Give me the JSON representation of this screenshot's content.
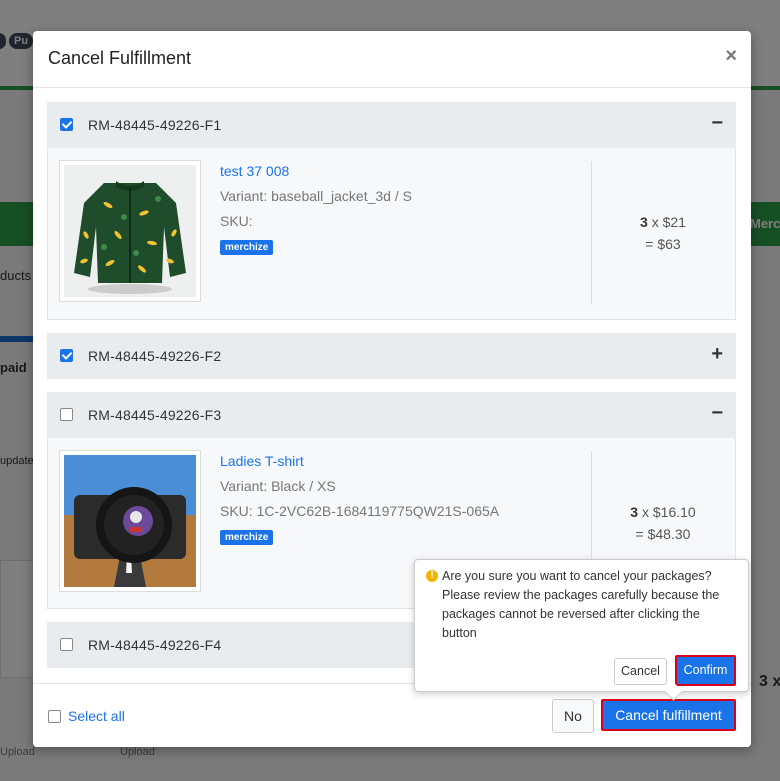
{
  "background": {
    "pill_label": "Pu",
    "text_fragments": [
      "ducts",
      "paid",
      "update",
      "Merc",
      "3 x",
      "Upload",
      "Upload"
    ]
  },
  "modal": {
    "title": "Cancel Fulfillment",
    "close_label": "×",
    "groups": [
      {
        "code": "RM-48445-49226-F1",
        "checked": true,
        "expanded": true,
        "toggle": "−",
        "item": {
          "title": "test 37 008",
          "variant": "Variant: baseball_jacket_3d / S",
          "sku": "SKU:",
          "badge": "merchize",
          "qty": "3",
          "unit_price": "$21",
          "total": "= $63"
        }
      },
      {
        "code": "RM-48445-49226-F2",
        "checked": true,
        "expanded": false,
        "toggle": "+"
      },
      {
        "code": "RM-48445-49226-F3",
        "checked": false,
        "expanded": true,
        "toggle": "−",
        "item": {
          "title": "Ladies T-shirt",
          "variant": "Variant: Black / XS",
          "sku": "SKU:  1C-2VC62B-1684119775QW21S-065A",
          "badge": "merchize",
          "qty": "3",
          "unit_price": "$16.10",
          "total": "= $48.30"
        }
      },
      {
        "code": "RM-48445-49226-F4",
        "checked": false,
        "expanded": false,
        "toggle": ""
      }
    ],
    "footer": {
      "select_all": "Select all",
      "no_label": "No",
      "cancel_fulfillment_label": "Cancel fulfillment"
    },
    "popover": {
      "message": "Are you sure you want to cancel your packages? Please review the packages carefully because the packages cannot be reversed after clicking the button",
      "cancel_label": "Cancel",
      "confirm_label": "Confirm"
    }
  },
  "colors": {
    "accent": "#1a73e8",
    "highlight_border": "#d9001b",
    "warning": "#f0b400",
    "badge_bg": "#1a73e8"
  },
  "icons": {
    "close": "close-icon",
    "collapse": "minus-icon",
    "expand": "plus-icon",
    "warning": "warning-icon"
  }
}
